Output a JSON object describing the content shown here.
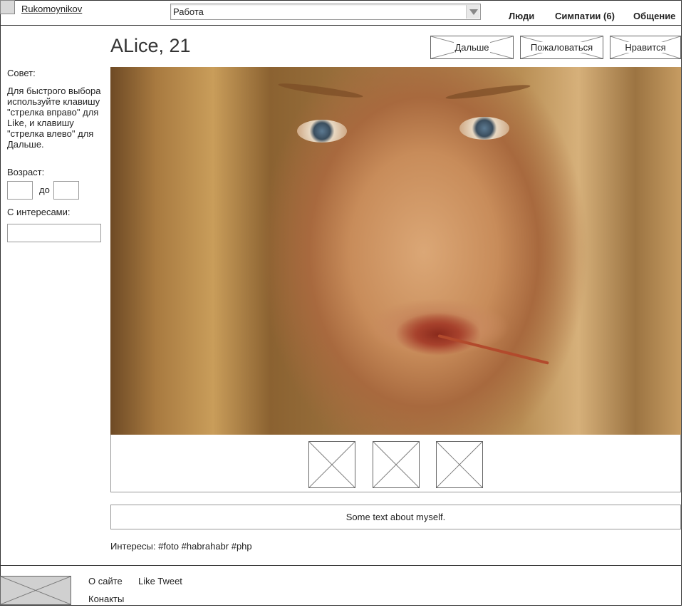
{
  "header": {
    "username": "Rukomoynikov",
    "select_value": "Работа",
    "nav": [
      {
        "label": "Люди"
      },
      {
        "label": "Симпатии (6)"
      },
      {
        "label": "Общение"
      }
    ]
  },
  "profile": {
    "title": "ALice, 21",
    "buttons": {
      "next": "Дальше",
      "report": "Пожаловаться",
      "like": "Нравится"
    },
    "about": "Some text about myself.",
    "interests": "Интересы: #foto #habrahabr #php"
  },
  "sidebar": {
    "tip_label": "Совет:",
    "tip_body": "Для быстрого выбора используйте клавишу \"стрелка вправо\" для Like, и клавишу \"стрелка влево\" для Дальше.",
    "age_label": "Возраст:",
    "age_to": "до",
    "interests_label": "С интересами:"
  },
  "footer": {
    "links": [
      {
        "label": "О сайте"
      },
      {
        "label": "Like Tweet"
      },
      {
        "label": "Конакты"
      }
    ]
  }
}
